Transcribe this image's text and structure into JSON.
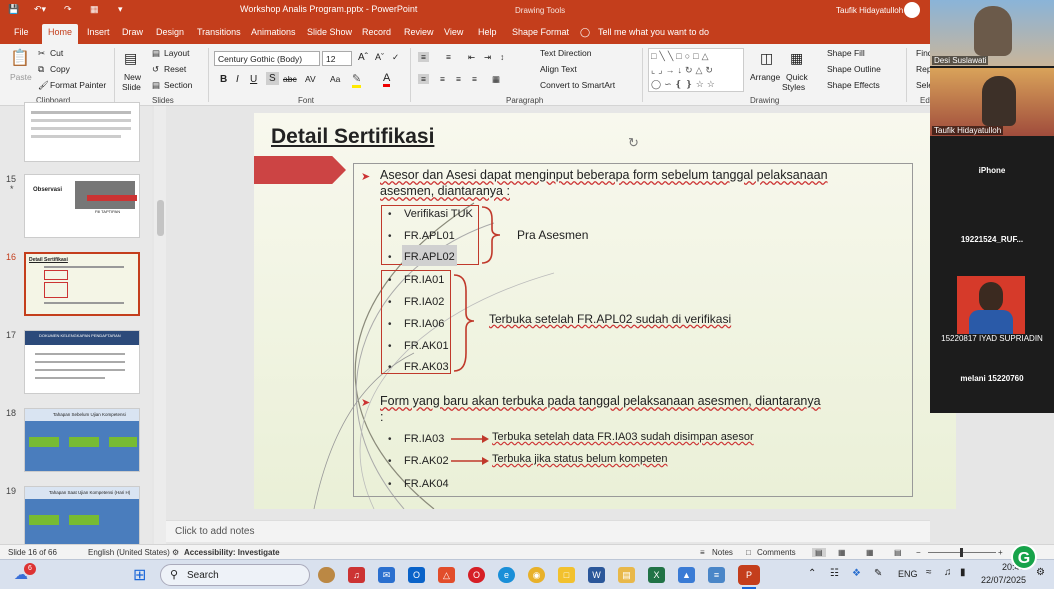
{
  "window": {
    "title": "Workshop Analis Program.pptx  -  PowerPoint",
    "drawing_tools": "Drawing Tools",
    "user": "Taufik Hidayatulloh"
  },
  "tabs": [
    "File",
    "Home",
    "Insert",
    "Draw",
    "Design",
    "Transitions",
    "Animations",
    "Slide Show",
    "Record",
    "Review",
    "View",
    "Help",
    "Shape Format"
  ],
  "tell_me": "Tell me what you want to do",
  "ribbon": {
    "clipboard": {
      "paste": "Paste",
      "cut": "Cut",
      "copy": "Copy",
      "format_painter": "Format Painter",
      "label": "Clipboard"
    },
    "slides": {
      "new_slide": "New",
      "new_slide2": "Slide",
      "layout": "Layout",
      "reset": "Reset",
      "section": "Section",
      "label": "Slides"
    },
    "font": {
      "name": "Century Gothic (Body)",
      "size": "12",
      "label": "Font"
    },
    "paragraph": {
      "text_direction": "Text Direction",
      "align_text": "Align Text",
      "smartart": "Convert to SmartArt",
      "label": "Paragraph"
    },
    "drawing": {
      "arrange": "Arrange",
      "quick": "Quick",
      "styles": "Styles",
      "fill": "Shape Fill",
      "outline": "Shape Outline",
      "effects": "Shape Effects",
      "label": "Drawing"
    },
    "editing": {
      "find": "Find",
      "replace": "Rep",
      "select": "Sele",
      "label": "Ed"
    }
  },
  "thumbs": {
    "15": {
      "num": "15",
      "star": "*",
      "title": "Observasi",
      "sub": "Fill TAPTIPAN"
    },
    "16": {
      "num": "16",
      "title": "Detail Sertifikasi"
    },
    "17": {
      "num": "17",
      "title": "DOKUMEN KELENGKAPAN PENDAFTARAN"
    },
    "18": {
      "num": "18",
      "title": "Tahapan Sebelum Ujian Kompetensi"
    },
    "19": {
      "num": "19",
      "title": "Tahapan Saat Ujian Kompetensi (Hari H)"
    }
  },
  "slide": {
    "title": "Detail Sertifikasi",
    "intro1": "Asesor dan Asesi dapat menginput beberapa form sebelum tanggal pelaksanaan",
    "intro2": "asesmen, diantaranya :",
    "pra_items": [
      "Verifikasi TUK",
      "FR.APL01",
      "FR.APL02"
    ],
    "pra_label": "Pra Asesmen",
    "open_items": [
      "FR.IA01",
      "FR.IA02",
      "FR.IA06",
      "FR.AK01",
      "FR.AK03"
    ],
    "open_label": "Terbuka setelah FR.APL02 sudah di verifikasi",
    "form1": "Form yang baru akan terbuka pada tanggal pelaksanaan asesmen, diantaranya",
    "form2": ":",
    "late_items": [
      "FR.IA03",
      "FR.AK02",
      "FR.AK04"
    ],
    "late_notes": [
      "Terbuka setelah data FR.IA03 sudah disimpan asesor",
      "Terbuka jika status belum kompeten"
    ]
  },
  "notes": "Click to add notes",
  "status": {
    "slide": "Slide 16 of 66",
    "lang": "English (United States)",
    "access": "Accessibility: Investigate",
    "notes": "Notes",
    "comments": "Comments"
  },
  "taskbar": {
    "search": "Search",
    "lang": "ENG",
    "time": "20:49",
    "date": "22/07/2025",
    "badge": "6"
  },
  "participants": {
    "p1": "Desi Suslawati",
    "p2": "Taufik Hidayatulloh",
    "p3": "iPhone",
    "p4": "19221524_RUF...",
    "p5": "15220817 IYAD SUPRIADIN",
    "p6": "melani 15220760"
  },
  "colors": {
    "accent": "#c43e1c",
    "box": "#c0392b"
  }
}
